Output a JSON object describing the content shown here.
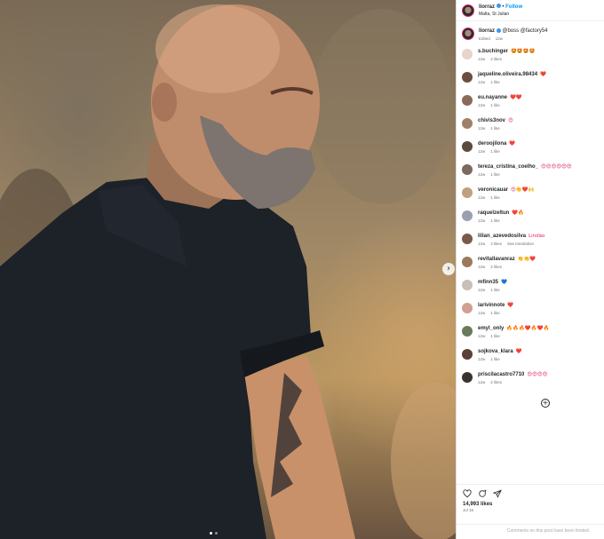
{
  "post": {
    "username": "liorraz",
    "follow_label": "Follow",
    "location": "Malta, St Julian"
  },
  "caption": {
    "username": "liorraz",
    "text": "@boss @factory54",
    "meta_edited": "Edited",
    "meta_time": "12w"
  },
  "comments": [
    {
      "user": "s.buchinger",
      "text": "🤩🤩🤩🤩",
      "time": "12w",
      "likes": "2 likes",
      "extra": "",
      "avatar": "#e8d4cc"
    },
    {
      "user": "jaqueline.oliveira.98434",
      "text": "❤️",
      "time": "12w",
      "likes": "1 like",
      "extra": "",
      "avatar": "#6b4e40"
    },
    {
      "user": "eu.nayanne",
      "text": "❤️❤️",
      "time": "12w",
      "likes": "1 like",
      "extra": "",
      "avatar": "#8a6a5a"
    },
    {
      "user": "chivis3nov",
      "text": "😍",
      "time": "12w",
      "likes": "1 like",
      "extra": "",
      "avatar": "#a0806a"
    },
    {
      "user": "deroojilona",
      "text": "❤️",
      "time": "12w",
      "likes": "1 like",
      "extra": "",
      "avatar": "#5a4a40"
    },
    {
      "user": "tereza_cristina_coelho_",
      "text": "😍😍😍😍😍😍",
      "time": "12w",
      "likes": "1 like",
      "extra": "",
      "avatar": "#7a6a60"
    },
    {
      "user": "veronicauar",
      "text": "😍👏❤️🙌",
      "time": "12w",
      "likes": "1 like",
      "extra": "",
      "avatar": "#c0a080"
    },
    {
      "user": "raquelzeltun",
      "text": "❤️🔥",
      "time": "12w",
      "likes": "1 like",
      "extra": "",
      "avatar": "#9aa0b0"
    },
    {
      "user": "lilian_azevedosilva",
      "text": "Lindão",
      "time": "12w",
      "likes": "3 likes",
      "extra": "See translation",
      "avatar": "#7a5a4a"
    },
    {
      "user": "revitallavanraz",
      "text": "👏👏❤️",
      "time": "12w",
      "likes": "2 likes",
      "extra": "",
      "avatar": "#9a7a5a"
    },
    {
      "user": "mfinn35",
      "text": "💙",
      "time": "12w",
      "likes": "1 like",
      "extra": "",
      "avatar": "#c8c0b8"
    },
    {
      "user": "larivinnote",
      "text": "❤️",
      "time": "12w",
      "likes": "1 like",
      "extra": "",
      "avatar": "#d0a090"
    },
    {
      "user": "emyl_only",
      "text": "🔥🔥🔥❤️🔥❤️🔥",
      "time": "12w",
      "likes": "1 like",
      "extra": "",
      "avatar": "#6a7a5a"
    },
    {
      "user": "sojkova_klara",
      "text": "❤️",
      "time": "12w",
      "likes": "1 like",
      "extra": "",
      "avatar": "#5a4038"
    },
    {
      "user": "priscilacastro7710",
      "text": "😍😍😍😍",
      "time": "12w",
      "likes": "2 likes",
      "extra": "",
      "avatar": "#3a3230"
    }
  ],
  "footer": {
    "likes": "14,993 likes",
    "date": "Jul 16",
    "limited_notice": "Comments on this post have been limited."
  },
  "colors": {
    "accent": "#0095f6",
    "text": "#262626",
    "muted": "#737373",
    "heart": "#e0245e"
  },
  "icons": [
    "chevron-right-icon",
    "plus-circle-icon",
    "heart-icon",
    "comment-icon",
    "share-icon",
    "verified-icon"
  ]
}
